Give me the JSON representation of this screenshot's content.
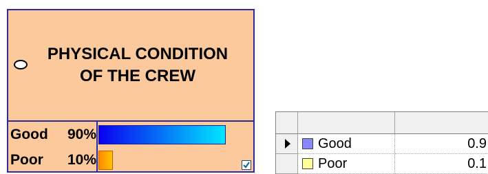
{
  "node": {
    "title": "PHYSICAL CONDITION\nOF THE CREW",
    "states": [
      {
        "name": "Good",
        "percent_label": "90%",
        "value": 0.9,
        "color_from": "#0a00f0",
        "color_to": "#00e8ff"
      },
      {
        "name": "Poor",
        "percent_label": "10%",
        "value": 0.1,
        "color_from": "#ff8a00",
        "color_to": "#ffc400"
      }
    ],
    "checkbox_checked": true,
    "fill_color": "#fcc99c",
    "border_color": "#2b2b9a"
  },
  "table": {
    "rows": [
      {
        "state": "Good",
        "value": "0.9",
        "swatch_color": "#8888ff",
        "selected": true
      },
      {
        "state": "Poor",
        "value": "0.1",
        "swatch_color": "#ffff99",
        "selected": false
      }
    ]
  }
}
